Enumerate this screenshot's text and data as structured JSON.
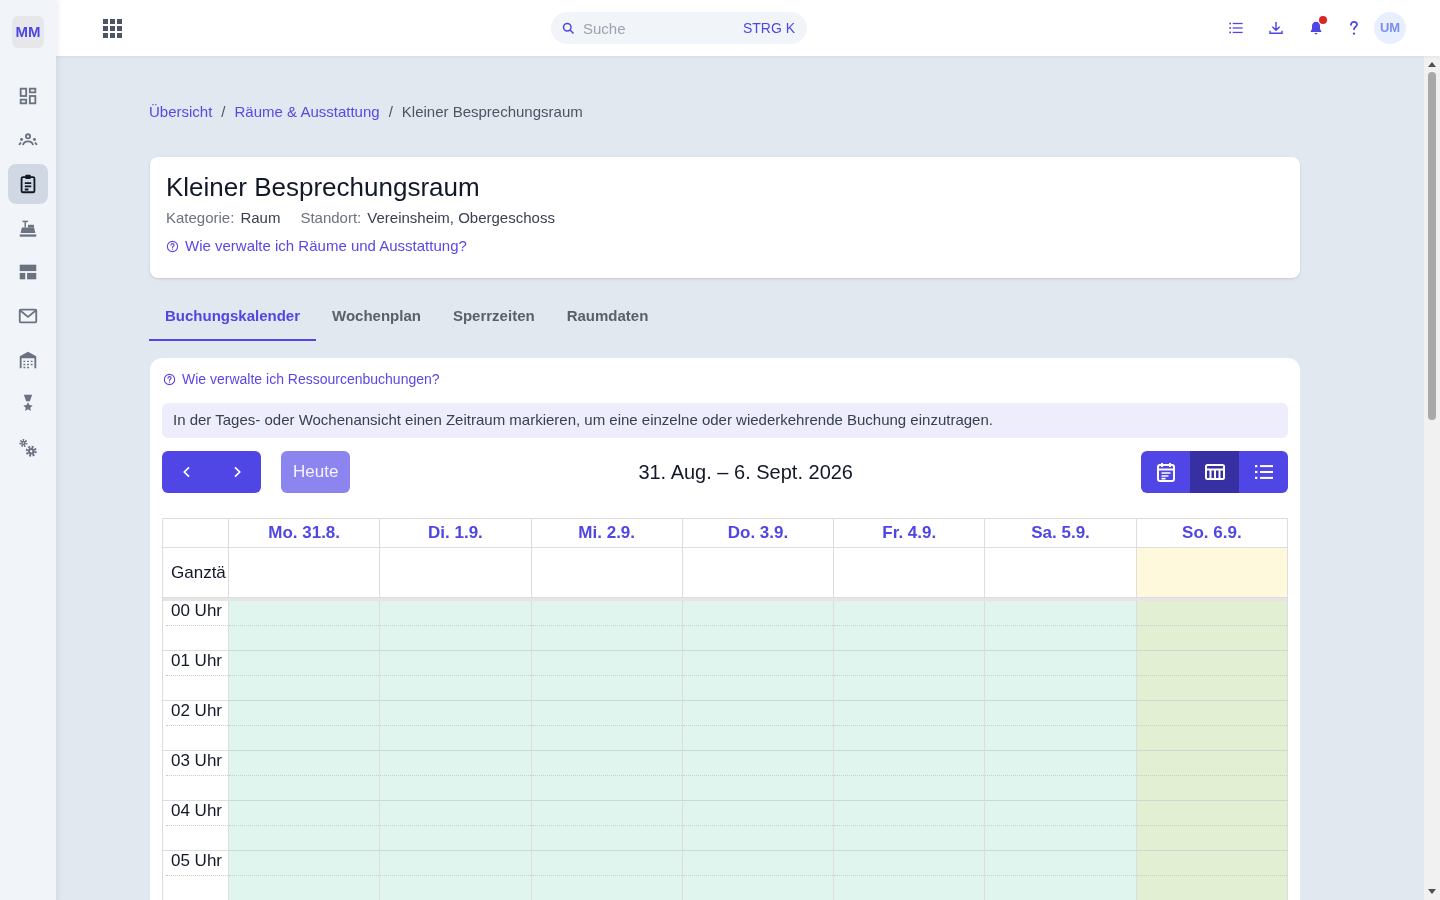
{
  "sidebar": {
    "logo": "MM",
    "items": [
      {
        "selected": false
      },
      {
        "selected": false
      },
      {
        "selected": true
      },
      {
        "selected": false
      },
      {
        "selected": false
      },
      {
        "selected": false
      },
      {
        "selected": false
      },
      {
        "selected": false
      },
      {
        "selected": false
      }
    ]
  },
  "topbar": {
    "search": {
      "placeholder": "Suche",
      "shortcut": "STRG K"
    },
    "notifications": {
      "unread": true
    },
    "avatar": "UM"
  },
  "breadcrumb": [
    {
      "kind": "link",
      "label": "Übersicht"
    },
    {
      "kind": "separator",
      "label": "/"
    },
    {
      "kind": "link",
      "label": "Räume & Ausstattung"
    },
    {
      "kind": "separator",
      "label": "/"
    },
    {
      "kind": "current",
      "label": "Kleiner Besprechungsraum"
    }
  ],
  "resource": {
    "title": "Kleiner Besprechungsraum",
    "meta": [
      {
        "label": "Kategorie:",
        "value": "Raum"
      },
      {
        "label": "Standort:",
        "value": "Vereinsheim, Obergeschoss"
      }
    ],
    "help_link": "Wie verwalte ich Räume und Ausstattung?"
  },
  "tabs": [
    {
      "label": "Buchungskalender",
      "selected": true
    },
    {
      "label": "Wochenplan",
      "selected": false
    },
    {
      "label": "Sperrzeiten",
      "selected": false
    },
    {
      "label": "Raumdaten",
      "selected": false
    }
  ],
  "calendar": {
    "help_link": "Wie verwalte ich Ressourcenbuchungen?",
    "hint": "In der Tages- oder Wochenansicht einen Zeitraum markieren, um eine einzelne oder wiederkehrende Buchung einzutragen.",
    "today_button": {
      "label": "Heute",
      "disabled": true
    },
    "range": "31. Aug. – 6. Sept. 2026",
    "views": [
      {
        "selected": false
      },
      {
        "selected": true
      },
      {
        "selected": false
      }
    ],
    "allday_label": "Ganztä",
    "days": [
      {
        "label": "Mo. 31.8.",
        "today": false
      },
      {
        "label": "Di. 1.9.",
        "today": false
      },
      {
        "label": "Mi. 2.9.",
        "today": false
      },
      {
        "label": "Do. 3.9.",
        "today": false
      },
      {
        "label": "Fr. 4.9.",
        "today": false
      },
      {
        "label": "Sa. 5.9.",
        "today": false
      },
      {
        "label": "So. 6.9.",
        "today": true
      }
    ],
    "hours": [
      "00 Uhr",
      "01 Uhr",
      "02 Uhr",
      "03 Uhr",
      "04 Uhr",
      "05 Uhr"
    ]
  }
}
